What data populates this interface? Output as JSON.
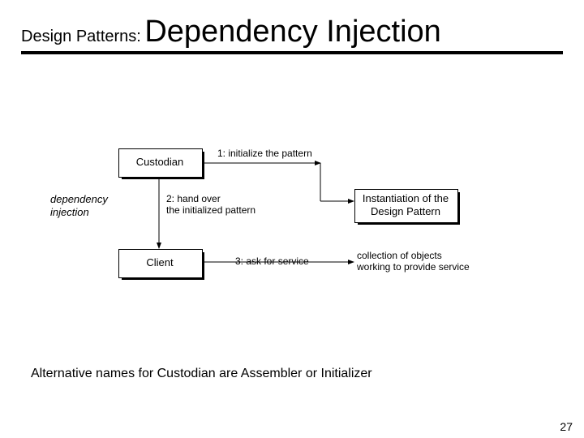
{
  "title": {
    "prefix": "Design Patterns:",
    "main": "Dependency Injection"
  },
  "diagram": {
    "side_label": "dependency\ninjection",
    "nodes": {
      "custodian": "Custodian",
      "client": "Client",
      "instantiation": "Instantiation of the\nDesign Pattern"
    },
    "edges": {
      "e1": "1: initialize the pattern",
      "e2": "2: hand over\n    the initialized pattern",
      "e3": "3: ask for service",
      "e3_right": "collection of objects\nworking to provide service"
    }
  },
  "footer": "Alternative names for Custodian are Assembler or Initializer",
  "page_number": "27"
}
